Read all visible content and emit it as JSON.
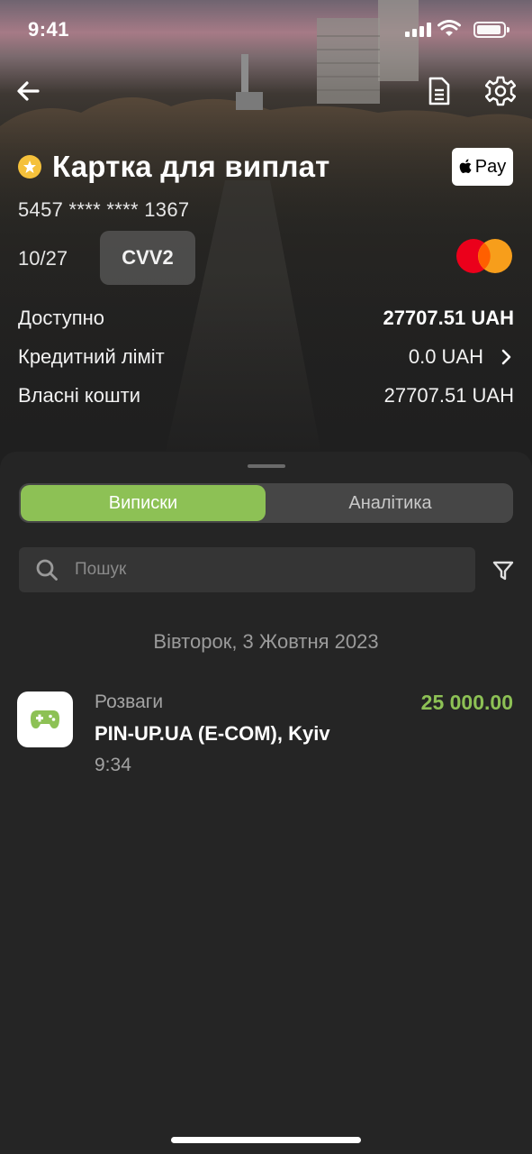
{
  "status_bar": {
    "time": "9:41"
  },
  "header": {
    "card_title": "Картка для виплат",
    "card_number": "5457 **** **** 1367",
    "expiry": "10/27",
    "cvv_label": "CVV2",
    "apple_pay_label": "Pay"
  },
  "balances": {
    "available": {
      "label": "Доступно",
      "value": "27707.51 UAH"
    },
    "credit_limit": {
      "label": "Кредитний ліміт",
      "value": "0.0 UAH"
    },
    "own_funds": {
      "label": "Власні кошти",
      "value": "27707.51 UAH"
    }
  },
  "tabs": [
    {
      "label": "Виписки",
      "active": true
    },
    {
      "label": "Аналітика",
      "active": false
    }
  ],
  "search": {
    "placeholder": "Пошук",
    "value": ""
  },
  "date_group": "Вівторок, 3 Жовтня 2023",
  "transactions": [
    {
      "category": "Розваги",
      "merchant": "PIN-UP.UA (E-COM), Kyiv",
      "time": "9:34",
      "amount": "25 000.00",
      "icon": "gamepad-icon"
    }
  ],
  "colors": {
    "accent_green": "#8dc155",
    "sheet_bg": "#252525",
    "star_gold": "#f5c13b",
    "mastercard_red": "#eb001b",
    "mastercard_orange": "#f79e1b"
  }
}
